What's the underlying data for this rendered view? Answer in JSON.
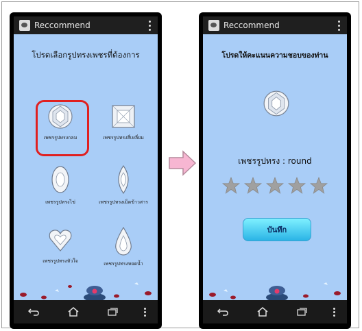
{
  "app": {
    "title": "Reccommend"
  },
  "left_screen": {
    "heading": "โปรดเลือกรูปทรงเพชรที่ต้องการ",
    "gems": [
      {
        "label": "เพชรรูปทรงกลม",
        "shape": "round",
        "selected": true
      },
      {
        "label": "เพชรรูปทรงสี่เหลี่ยม",
        "shape": "princess",
        "selected": false
      },
      {
        "label": "เพชรรูปทรงไข่",
        "shape": "oval",
        "selected": false
      },
      {
        "label": "เพชรรูปทรงเม็ดข้าวสาร",
        "shape": "marquise",
        "selected": false
      },
      {
        "label": "เพชรรูปทรงหัวใจ",
        "shape": "heart",
        "selected": false
      },
      {
        "label": "เพชรรูปทรงหยดน้ำ",
        "shape": "pear",
        "selected": false
      }
    ]
  },
  "right_screen": {
    "heading": "โปรดให้คะแนนความชอบของท่าน",
    "shape_text": "เพชรรูปทรง : round",
    "rating": {
      "filled": 0,
      "max": 5
    },
    "save_label": "บันทึก"
  },
  "colors": {
    "screen_bg": "#a9cdf7",
    "star": "#a0a0a0",
    "selected_ring": "#e02020",
    "arrow": "#f7b6d2"
  }
}
